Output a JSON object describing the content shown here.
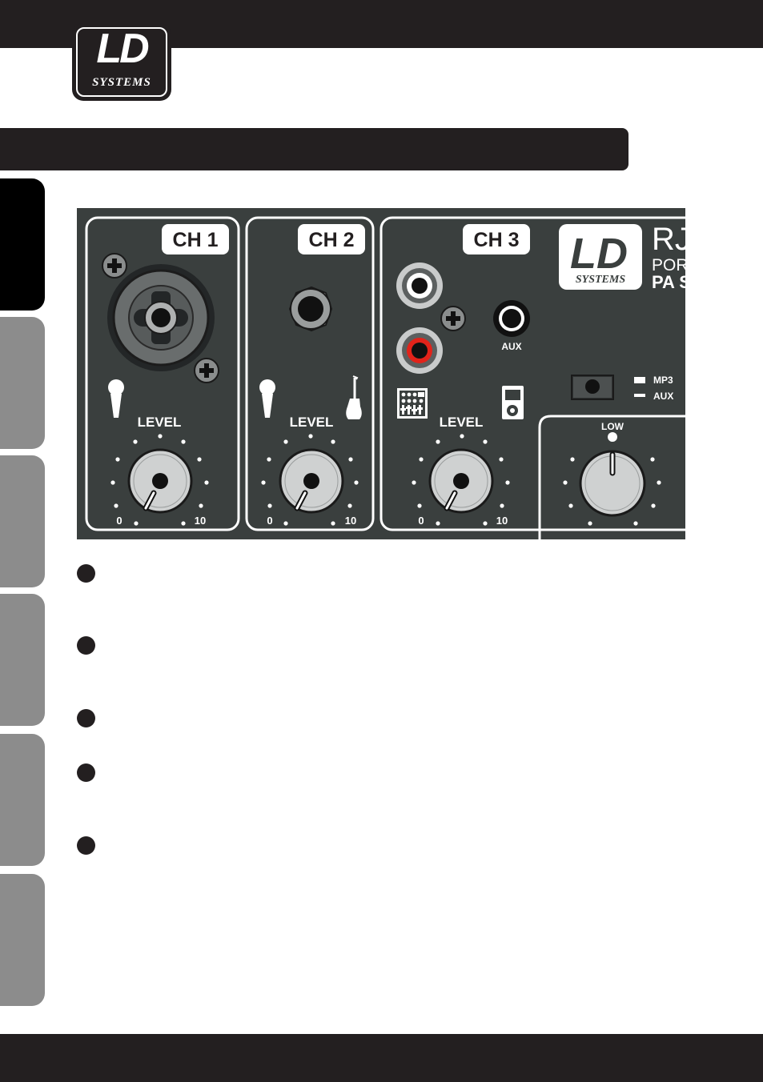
{
  "logo": {
    "brand": "LD",
    "sub": "SYSTEMS"
  },
  "panel": {
    "channels": [
      {
        "label": "CH 1",
        "level_label": "LEVEL",
        "scale_min": "0",
        "scale_max": "10"
      },
      {
        "label": "CH 2",
        "level_label": "LEVEL",
        "scale_min": "0",
        "scale_max": "10"
      },
      {
        "label": "CH 3",
        "level_label": "LEVEL",
        "scale_min": "0",
        "scale_max": "10"
      }
    ],
    "aux_label": "AUX",
    "switch_labels": {
      "mp3": "MP3",
      "aux": "AUX"
    },
    "eq_label": "LOW",
    "product": {
      "model": "RJ",
      "line1": "PORT",
      "line2": "PA S"
    },
    "panel_logo": {
      "brand": "LD",
      "sub": "SYSTEMS"
    }
  },
  "colors": {
    "page_bars": "#231f20",
    "panel": "#3a3f3e",
    "tab_active": "#000000",
    "tab_inactive": "#8c8c8c",
    "rca_red": "#e2231a"
  }
}
